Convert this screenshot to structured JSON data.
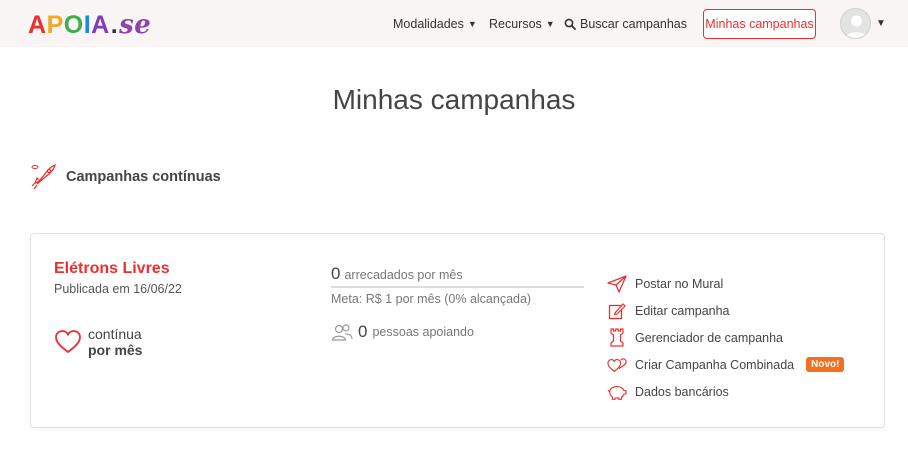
{
  "header": {
    "logo": "APOIA.se",
    "nav": [
      {
        "label": "Modalidades",
        "has_caret": true
      },
      {
        "label": "Recursos",
        "has_caret": true
      },
      {
        "label": "Buscar campanhas",
        "icon": "search-icon"
      }
    ],
    "my_campaigns_button": "Minhas campanhas"
  },
  "page": {
    "title": "Minhas campanhas",
    "section_title": "Campanhas contínuas"
  },
  "campaign": {
    "name": "Elétrons Livres",
    "published": "Publicada em 16/06/22",
    "kind_line1": "contínua",
    "kind_line2": "por mês",
    "raised_amount": "0",
    "raised_label": "arrecadados por mês",
    "goal": "Meta: R$ 1 por mês (0% alcançada)",
    "supporters_count": "0",
    "supporters_label": "pessoas apoiando",
    "actions": [
      {
        "label": "Postar no Mural",
        "icon": "paper-plane-icon"
      },
      {
        "label": "Editar campanha",
        "icon": "edit-icon"
      },
      {
        "label": "Gerenciador de campanha",
        "icon": "chess-rook-icon"
      },
      {
        "label": "Criar Campanha Combinada",
        "icon": "hearts-icon",
        "badge": "Novo!"
      },
      {
        "label": "Dados bancários",
        "icon": "piggy-bank-icon"
      }
    ]
  },
  "colors": {
    "accent": "#e8312f",
    "badge": "#f36f21",
    "header_bg": "#f8f5f4"
  }
}
